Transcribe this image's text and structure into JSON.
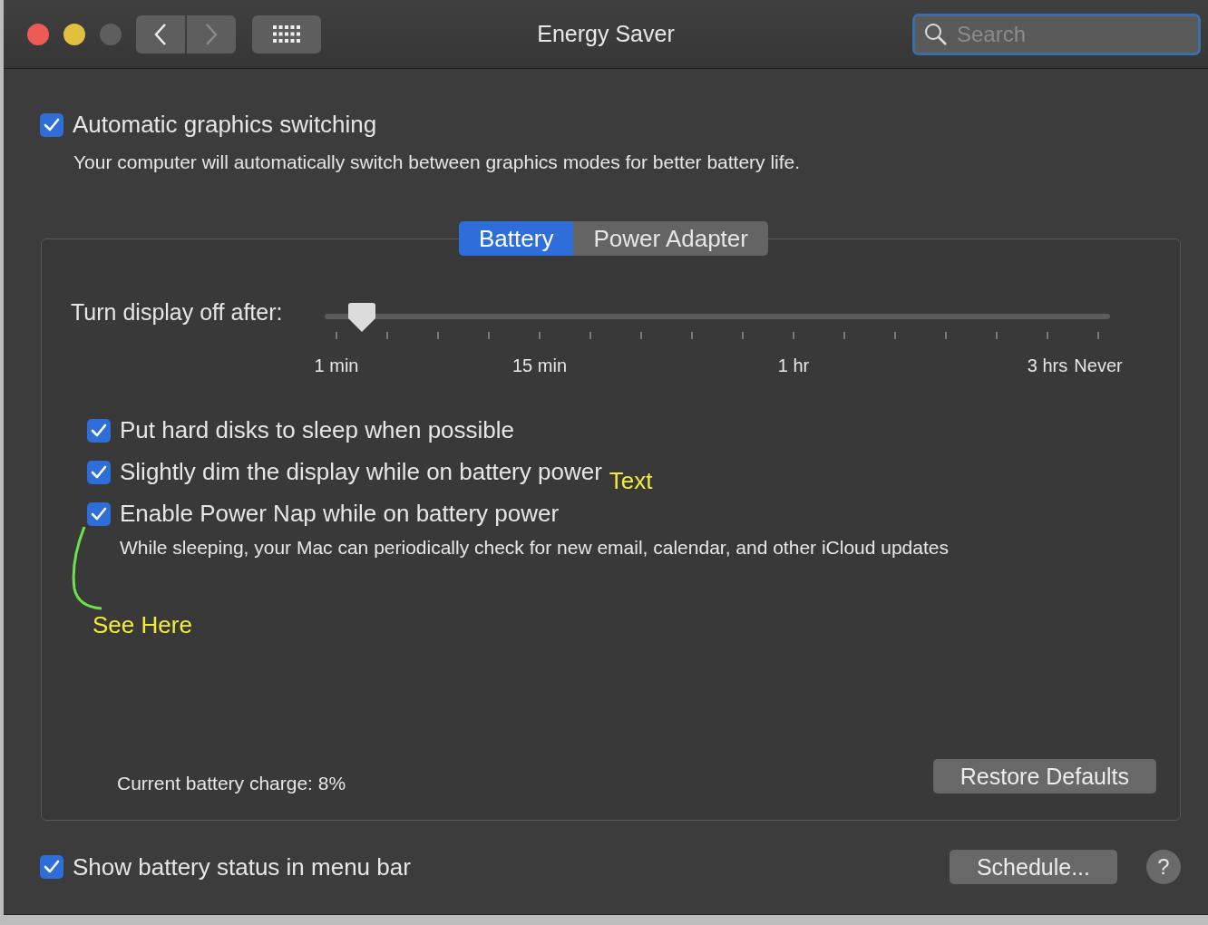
{
  "window": {
    "title": "Energy Saver",
    "search": {
      "placeholder": "Search"
    }
  },
  "graphics_switching": {
    "label": "Automatic graphics switching",
    "checked": true,
    "description": "Your computer will automatically switch between graphics modes for better battery life."
  },
  "tabs": [
    {
      "label": "Battery",
      "selected": true
    },
    {
      "label": "Power Adapter",
      "selected": false
    }
  ],
  "display_slider": {
    "label": "Turn display off after:",
    "level": 0.033,
    "ticks": [
      {
        "kind": "labeled",
        "label": "1 min"
      },
      {
        "kind": "plain"
      },
      {
        "kind": "plain"
      },
      {
        "kind": "plain"
      },
      {
        "kind": "labeled",
        "label": "15 min"
      },
      {
        "kind": "plain"
      },
      {
        "kind": "plain"
      },
      {
        "kind": "plain"
      },
      {
        "kind": "plain"
      },
      {
        "kind": "labeled",
        "label": "1 hr"
      },
      {
        "kind": "plain"
      },
      {
        "kind": "plain"
      },
      {
        "kind": "plain"
      },
      {
        "kind": "plain"
      },
      {
        "kind": "labeled",
        "label": "3 hrs"
      },
      {
        "kind": "labeled",
        "label": "Never"
      }
    ]
  },
  "options": [
    {
      "label": "Put hard disks to sleep when possible",
      "checked": true
    },
    {
      "label": "Slightly dim the display while on battery power",
      "checked": true
    },
    {
      "label": "Enable Power Nap while on battery power",
      "checked": true,
      "description": "While sleeping, your Mac can periodically check for new email, calendar, and other iCloud updates"
    }
  ],
  "annotations": [
    {
      "text": "Text"
    },
    {
      "text": "See Here"
    }
  ],
  "battery_charge": "Current battery charge: 8%",
  "restore_button": "Restore Defaults",
  "menu_bar_status": {
    "label": "Show battery status in menu bar",
    "checked": true
  },
  "schedule_button": "Schedule...",
  "help_button": "?"
}
